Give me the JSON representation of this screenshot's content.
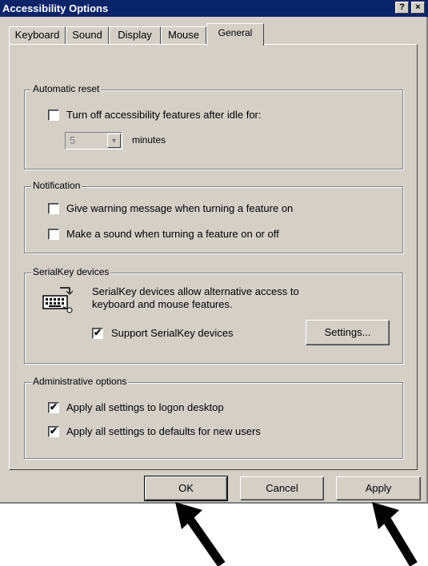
{
  "window": {
    "title": "Accessibility Options",
    "help_button": "?",
    "close_button": "×"
  },
  "tabs": [
    {
      "label": "Keyboard"
    },
    {
      "label": "Sound"
    },
    {
      "label": "Display"
    },
    {
      "label": "Mouse"
    },
    {
      "label": "General",
      "active": true
    }
  ],
  "automatic_reset": {
    "legend": "Automatic reset",
    "checkbox_label": "Turn off accessibility features after idle for:",
    "checked": false,
    "minutes_value": "5",
    "minutes_label": "minutes"
  },
  "notification": {
    "legend": "Notification",
    "warning_label": "Give warning message when turning a feature on",
    "warning_checked": false,
    "sound_label": "Make a sound when turning a feature on or off",
    "sound_checked": false
  },
  "serialkey": {
    "legend": "SerialKey devices",
    "description_line1": "SerialKey devices allow alternative access to",
    "description_line2": "keyboard and mouse features.",
    "support_label": "Support SerialKey devices",
    "support_checked": true,
    "settings_button": "Settings..."
  },
  "administrative": {
    "legend": "Administrative options",
    "logon_label": "Apply all settings to logon desktop",
    "logon_checked": true,
    "defaults_label": "Apply all settings to defaults for new users",
    "defaults_checked": true
  },
  "footer": {
    "ok_button": "OK",
    "cancel_button": "Cancel",
    "apply_button": "Apply"
  },
  "colors": {
    "titlebar": "#0a246a",
    "face": "#d4d0c8"
  },
  "icons": {
    "keyboard": "keyboard-icon",
    "arrow": "arrow-pointer-icon",
    "dropdown": "chevron-down-icon",
    "check": "checkmark-icon"
  }
}
